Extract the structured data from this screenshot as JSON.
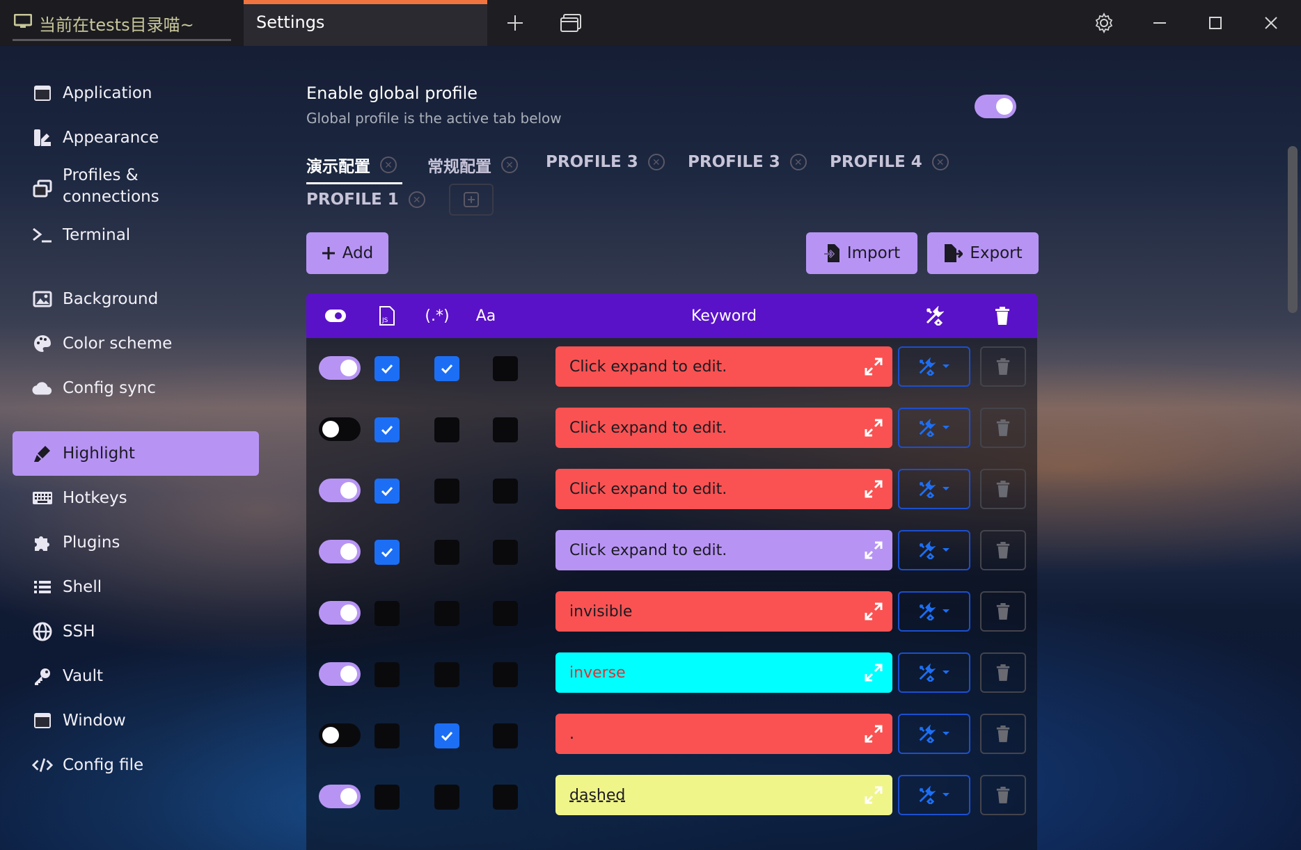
{
  "titlebar": {
    "terminal_tab": "当前在tests目录喵~",
    "settings_tab": "Settings"
  },
  "sidebar": {
    "items": [
      {
        "label": "Application",
        "icon": "window-icon"
      },
      {
        "label": "Appearance",
        "icon": "paint-icon"
      },
      {
        "label": "Profiles &",
        "label2": "connections",
        "icon": "profiles-icon"
      },
      {
        "label": "Terminal",
        "icon": "terminal-icon"
      },
      {
        "label": "Background",
        "icon": "image-icon"
      },
      {
        "label": "Color scheme",
        "icon": "palette-icon"
      },
      {
        "label": "Config sync",
        "icon": "cloud-icon"
      },
      {
        "label": "Highlight",
        "icon": "highlighter-icon",
        "active": true
      },
      {
        "label": "Hotkeys",
        "icon": "keyboard-icon"
      },
      {
        "label": "Plugins",
        "icon": "puzzle-icon"
      },
      {
        "label": "Shell",
        "icon": "list-icon"
      },
      {
        "label": "SSH",
        "icon": "globe-icon"
      },
      {
        "label": "Vault",
        "icon": "key-icon"
      },
      {
        "label": "Window",
        "icon": "window-icon"
      },
      {
        "label": "Config file",
        "icon": "code-icon"
      }
    ]
  },
  "global_profile": {
    "title": "Enable global profile",
    "subtitle": "Global profile is the active tab below",
    "enabled": true
  },
  "profile_tabs": [
    "演示配置",
    "常规配置",
    "PROFILE 3",
    "PROFILE 3",
    "PROFILE 4",
    "PROFILE 1"
  ],
  "buttons": {
    "add": "Add",
    "import": "Import",
    "export": "Export"
  },
  "table": {
    "headers": {
      "enabled": "toggle-icon",
      "js": "JS",
      "regex": "(.*)",
      "case": "Aa",
      "keyword": "Keyword",
      "actions": "tools-icon",
      "delete": "trash-icon"
    },
    "rows": [
      {
        "enabled": true,
        "js": true,
        "regex": true,
        "case": false,
        "keyword": "Click expand to edit.",
        "color": "#fa5252",
        "text_color": "#1c1a22"
      },
      {
        "enabled": false,
        "js": true,
        "regex": false,
        "case": false,
        "keyword": "Click expand to edit.",
        "color": "#fa5252",
        "text_color": "#1c1a22"
      },
      {
        "enabled": true,
        "js": true,
        "regex": false,
        "case": false,
        "keyword": "Click expand to edit.",
        "color": "#fa5252",
        "text_color": "#1c1a22"
      },
      {
        "enabled": true,
        "js": true,
        "regex": false,
        "case": false,
        "keyword": "Click expand to edit.",
        "color": "#b794f4",
        "text_color": "#1c1a22"
      },
      {
        "enabled": true,
        "js": false,
        "regex": false,
        "case": false,
        "keyword": "invisible",
        "color": "#fa5252",
        "text_color": "#1c1a22"
      },
      {
        "enabled": true,
        "js": false,
        "regex": false,
        "case": false,
        "keyword": "inverse",
        "color": "#00ffff",
        "text_color": "#e03131"
      },
      {
        "enabled": false,
        "js": false,
        "regex": true,
        "case": false,
        "keyword": ".",
        "color": "#fa5252",
        "text_color": "#1c1a22"
      },
      {
        "enabled": true,
        "js": false,
        "regex": false,
        "case": false,
        "keyword": "dashed",
        "color": "#f0f58a",
        "text_color": "#1c1a22"
      }
    ]
  },
  "colors": {
    "accent": "#b794f4",
    "header": "#5a12c8",
    "checkbox": "#1c6ff5"
  }
}
